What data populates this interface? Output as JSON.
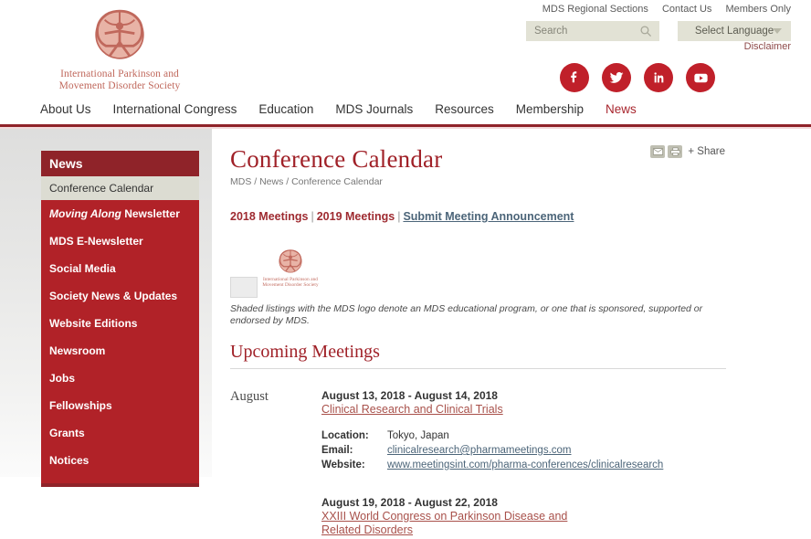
{
  "header": {
    "logo_name": "mds-logo",
    "logo_text_line1": "International Parkinson and",
    "logo_text_line2": "Movement Disorder Society",
    "util_links": [
      {
        "label": "MDS Regional Sections"
      },
      {
        "label": "Contact Us"
      },
      {
        "label": "Members Only"
      }
    ],
    "search": {
      "placeholder": "Search",
      "value": ""
    },
    "language": {
      "label": "Select Language"
    },
    "disclaimer": "Disclaimer",
    "social": [
      {
        "name": "facebook-icon"
      },
      {
        "name": "twitter-icon"
      },
      {
        "name": "linkedin-icon"
      },
      {
        "name": "youtube-icon"
      }
    ],
    "nav": [
      {
        "label": "About Us",
        "active": false
      },
      {
        "label": "International Congress",
        "active": false
      },
      {
        "label": "Education",
        "active": false
      },
      {
        "label": "MDS Journals",
        "active": false
      },
      {
        "label": "Resources",
        "active": false
      },
      {
        "label": "Membership",
        "active": false
      },
      {
        "label": "News",
        "active": true
      }
    ]
  },
  "sidebar": {
    "heading": "News",
    "items": [
      {
        "label": "Conference Calendar",
        "active": true
      },
      {
        "label_italic": "Moving Along",
        "label": " Newsletter",
        "active": false
      },
      {
        "label": "MDS E-Newsletter",
        "active": false
      },
      {
        "label": "Social Media",
        "active": false
      },
      {
        "label": "Society News & Updates",
        "active": false
      },
      {
        "label": "Website Editions",
        "active": false
      },
      {
        "label": "Newsroom",
        "active": false
      },
      {
        "label": "Jobs",
        "active": false
      },
      {
        "label": "Fellowships",
        "active": false
      },
      {
        "label": "Grants",
        "active": false
      },
      {
        "label": "Notices",
        "active": false
      }
    ]
  },
  "main": {
    "title": "Conference Calendar",
    "breadcrumb": "MDS / News / Conference Calendar",
    "share": {
      "label": "+ Share"
    },
    "year_links": {
      "y2018": "2018 Meetings",
      "sep": "|",
      "y2019": "2019 Meetings",
      "submit": "Submit Meeting Announcement"
    },
    "legend_note": "Shaded listings with the MDS logo denote an MDS educational program, or one that is sponsored, supported or endorsed by MDS.",
    "section_title": "Upcoming Meetings",
    "months": [
      {
        "name": "August",
        "events": [
          {
            "dates": "August 13, 2018 - August 14, 2018",
            "name": "Clinical Research and Clinical Trials",
            "details": [
              {
                "key": "Location:",
                "value": "Tokyo, Japan",
                "link": false
              },
              {
                "key": "Email:",
                "value": "clinicalresearch@pharmameetings.com",
                "link": true
              },
              {
                "key": "Website:",
                "value": "www.meetingsint.com/pharma-conferences/clinicalresearch",
                "link": true
              }
            ]
          },
          {
            "dates": "August 19, 2018 - August 22, 2018",
            "name": "XXIII World Congress on Parkinson Disease and Related Disorders",
            "details": []
          }
        ]
      }
    ]
  },
  "colors": {
    "brand_red": "#a02128",
    "sidebar_red": "#b12228",
    "sidebar_dark_red": "#8f2329",
    "link_blue": "#4c6579",
    "logo_salmon": "#c0685c"
  }
}
